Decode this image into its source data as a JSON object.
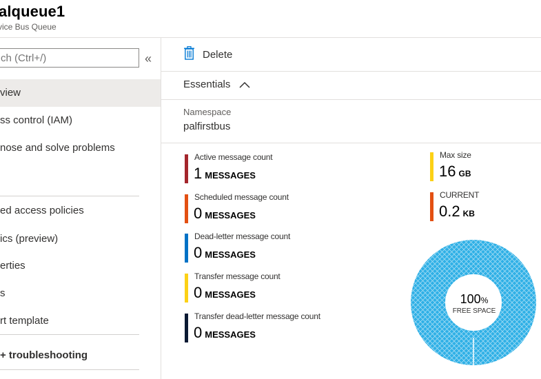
{
  "header": {
    "title": "alqueue1",
    "subtitle": "vice Bus Queue"
  },
  "sidebar": {
    "search_placeholder": "ch (Ctrl+/)",
    "collapse_glyph": "«",
    "items": [
      {
        "label": "view"
      },
      {
        "label": "ss control (IAM)"
      },
      {
        "label": "nose and solve problems"
      },
      {
        "label": "ed access policies"
      },
      {
        "label": "ics (preview)"
      },
      {
        "label": "erties"
      },
      {
        "label": "s"
      },
      {
        "label": "rt template"
      },
      {
        "label": "+ troubleshooting"
      }
    ]
  },
  "toolbar": {
    "delete_label": "Delete"
  },
  "essentials": {
    "label": "Essentials",
    "namespace_label": "Namespace",
    "namespace_value": "palfirstbus"
  },
  "metrics": [
    {
      "label": "Active message count",
      "value": "1",
      "unit": "MESSAGES",
      "color": "#a4262c"
    },
    {
      "label": "Scheduled message count",
      "value": "0",
      "unit": "MESSAGES",
      "color": "#e35012"
    },
    {
      "label": "Dead-letter message count",
      "value": "0",
      "unit": "MESSAGES",
      "color": "#0072c6"
    },
    {
      "label": "Transfer message count",
      "value": "0",
      "unit": "MESSAGES",
      "color": "#fcd116"
    },
    {
      "label": "Transfer dead-letter message count",
      "value": "0",
      "unit": "MESSAGES",
      "color": "#0b1a33"
    }
  ],
  "size": {
    "max_label": "Max size",
    "max_value": "16",
    "max_unit": "GB",
    "max_color": "#fcd116",
    "current_label": "CURRENT",
    "current_value": "0.2",
    "current_unit": "KB",
    "current_color": "#e35012"
  },
  "donut": {
    "percent": "100",
    "percent_sign": "%",
    "text": "FREE SPACE",
    "color": "#2fb0e6"
  }
}
